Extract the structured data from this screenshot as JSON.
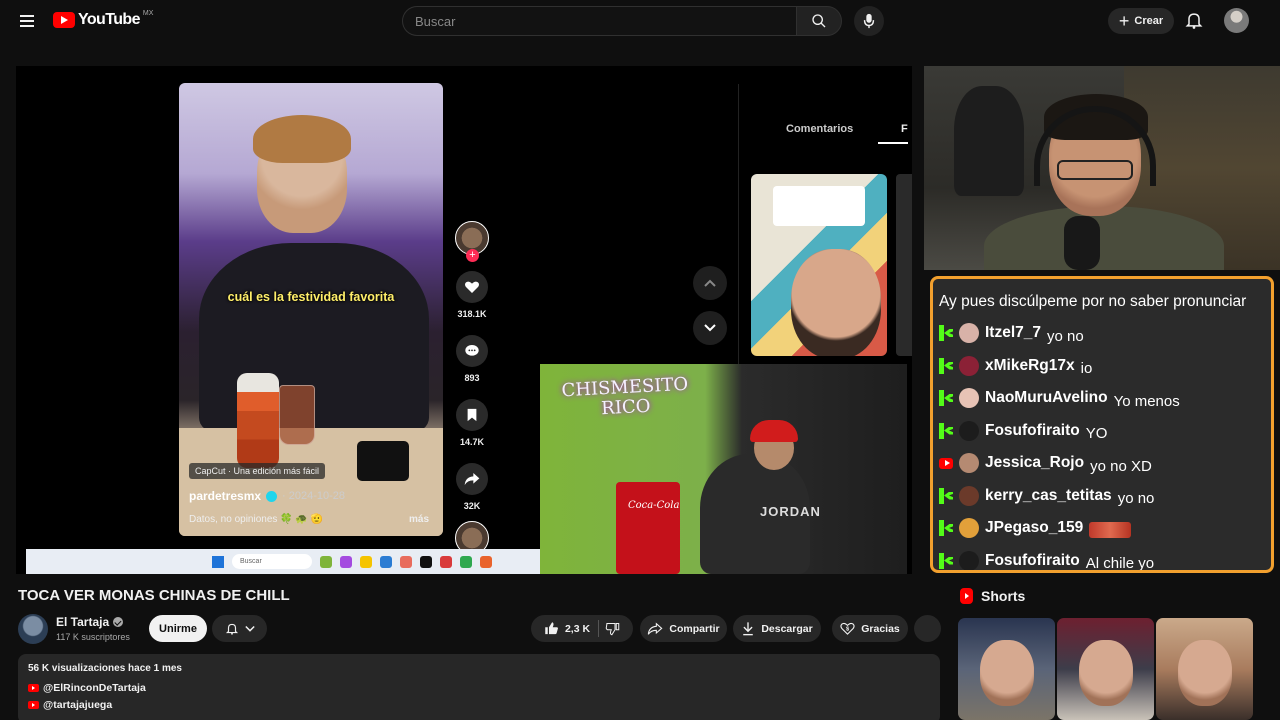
{
  "header": {
    "logo_text": "YouTube",
    "country_code": "MX",
    "search_placeholder": "Buscar",
    "create_label": "Crear",
    "colors": {
      "brand_red": "#ff0000",
      "background": "#0f0f0f",
      "chat_border": "#f2a02e",
      "kick_green": "#53fc18"
    }
  },
  "player": {
    "tiktok": {
      "caption": "cuál es la festividad favorita",
      "capcut_badge": "CapCut · Una edición más fácil",
      "username": "pardetresmx",
      "date": "· 2024-10-28",
      "description": "Datos, no opiniones 🍀 🐢 🫡",
      "more": "más",
      "likes": "318.1K",
      "comments": "893",
      "saves": "14.7K",
      "shares": "32K",
      "comments_tab": "Comentarios",
      "tab_partial": "F"
    },
    "overlay_sign": "CHISMESITO\nRICO",
    "fridge_label": "Coca-Cola",
    "shirt_text": "JORDAN",
    "taskbar_search": "Buscar"
  },
  "chat": {
    "first_line": "Ay pues discúlpeme por no saber pronunciar",
    "messages": [
      {
        "platform": "kick",
        "user": "Itzel7_7",
        "text": "yo no",
        "avatar_color": "#d8b2a8"
      },
      {
        "platform": "kick",
        "user": "xMikeRg17x",
        "text": "io",
        "avatar_color": "#8b2136"
      },
      {
        "platform": "kick",
        "user": "NaoMuruAvelino",
        "text": "Yo menos",
        "avatar_color": "#e7c3b5"
      },
      {
        "platform": "kick",
        "user": "Fosufofiraito",
        "text": "YO",
        "avatar_color": "#1c1c1c"
      },
      {
        "platform": "youtube",
        "user": "Jessica_Rojo",
        "text": "yo no XD",
        "avatar_color": "#b58a72"
      },
      {
        "platform": "kick",
        "user": "kerry_cas_tetitas",
        "text": "yo no",
        "avatar_color": "#6b3a2a"
      },
      {
        "platform": "kick",
        "user": "JPegaso_159",
        "text": "",
        "avatar_color": "#e2a03a",
        "emote": true
      },
      {
        "platform": "kick",
        "user": "Fosufofiraito",
        "text": "Al chile yo",
        "avatar_color": "#1c1c1c"
      }
    ]
  },
  "video": {
    "title": "TOCA VER MONAS CHINAS DE CHILL",
    "channel_name": "El Tartaja",
    "subscribers": "117 K suscriptores",
    "join_label": "Unirme",
    "likes": "2,3 K",
    "share_label": "Compartir",
    "download_label": "Descargar",
    "thanks_label": "Gracias"
  },
  "description": {
    "meta": "56 K visualizaciones  hace 1 mes",
    "links": [
      "@ElRinconDeTartaja",
      "@tartajajuega"
    ]
  },
  "shorts": {
    "title": "Shorts"
  }
}
